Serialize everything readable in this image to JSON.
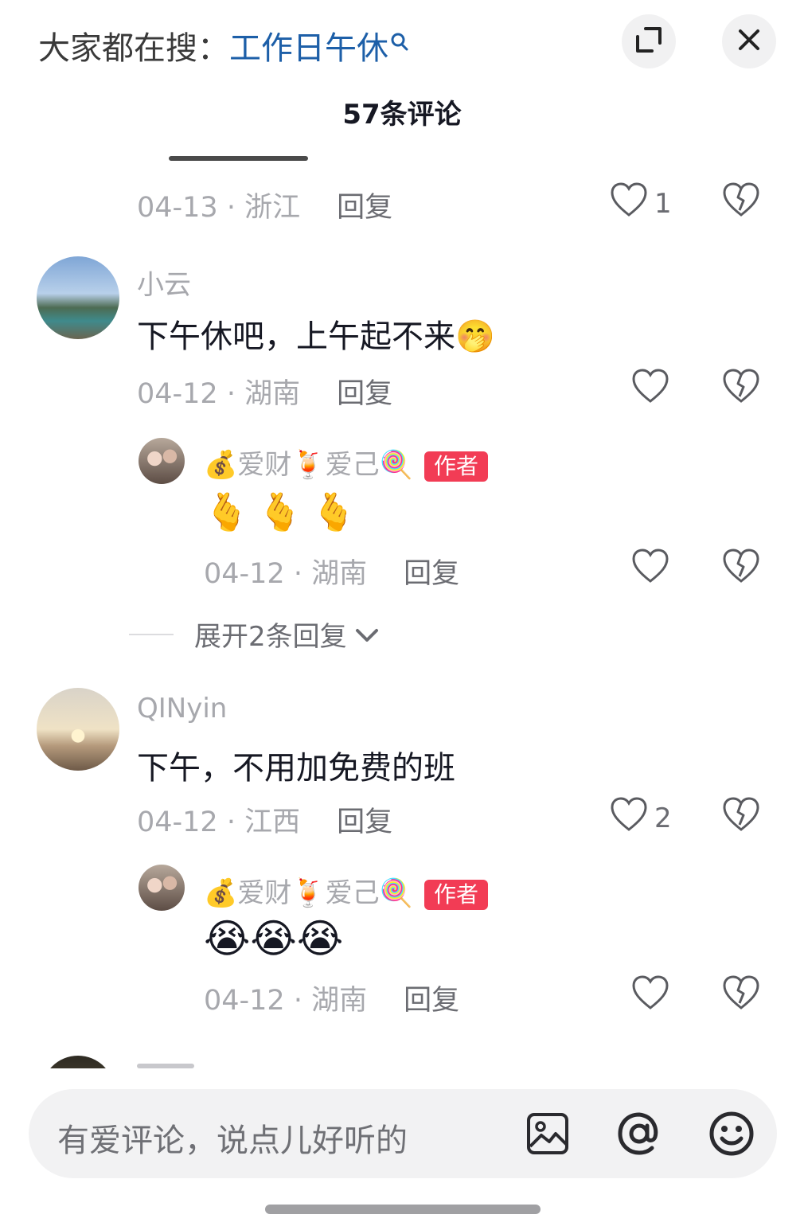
{
  "header": {
    "search_prefix": "大家都在搜：",
    "search_term": "工作日午休",
    "comment_count_title": "57条评论"
  },
  "comments": [
    {
      "meta_date": "04-13 · 浙江",
      "reply_label": "回复",
      "like_count": "1"
    },
    {
      "name": "小云",
      "text": "下午休吧，上午起不来🤭",
      "meta_date": "04-12 · 湖南",
      "reply_label": "回复",
      "like_count": "",
      "reply": {
        "name": "💰爱财🍹爱己🍭",
        "author_tag": "作者",
        "text": "🫰🫰🫰",
        "meta_date": "04-12 · 湖南",
        "reply_label": "回复"
      },
      "expand_label": "展开2条回复"
    },
    {
      "name": "QINyin",
      "text": "下午，不用加免费的班",
      "meta_date": "04-12 · 江西",
      "reply_label": "回复",
      "like_count": "2",
      "reply": {
        "name": "💰爱财🍹爱己🍭",
        "author_tag": "作者",
        "text": "😭😭😭",
        "meta_date": "04-12 · 湖南",
        "reply_label": "回复"
      }
    }
  ],
  "input": {
    "placeholder": "有爱评论，说点儿好听的"
  },
  "icons": {
    "expand": "fullscreen-icon",
    "close": "close-icon",
    "like": "heart-outline-icon",
    "dislike": "broken-heart-icon",
    "image": "image-icon",
    "mention": "at-icon",
    "emoji": "smiley-icon"
  },
  "colors": {
    "search_term": "#1d5fa8",
    "author_tag_bg": "#f23c55",
    "secondary_text": "#a7a8ad"
  }
}
